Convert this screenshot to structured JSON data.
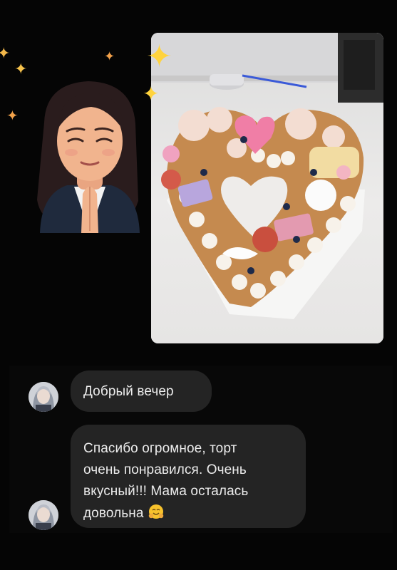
{
  "messages": [
    {
      "text_lines": [
        "Добрый вечер"
      ]
    },
    {
      "text_lines": [
        "Спасибо огромное, торт",
        "очень понравился. Очень",
        "вкусный!!! Мама осталась",
        "довольна"
      ],
      "emoji": "hugging-face-icon"
    }
  ],
  "colors": {
    "background": "#050505",
    "bubble": "#242424",
    "bubble_text": "#ececec",
    "sparkle": "#ffd33d"
  },
  "icons": [
    "sparkle-icon",
    "hugging-face-icon"
  ]
}
